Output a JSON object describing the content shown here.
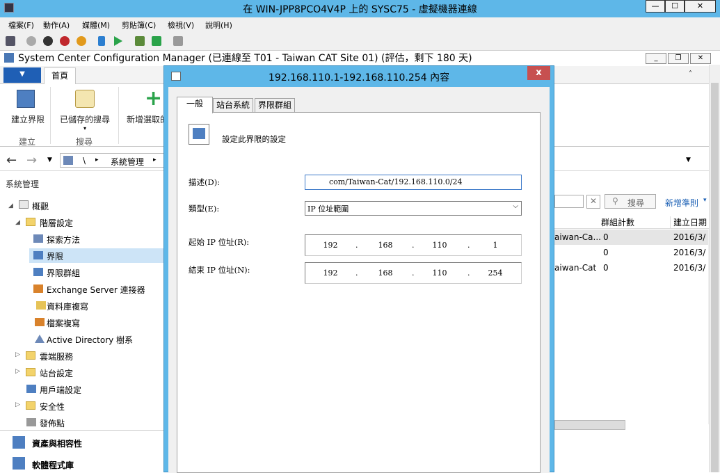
{
  "vm": {
    "title": "在 WIN-JPP8PCO4V4P 上的 SYSC75 - 虛擬機器連線",
    "menu": [
      "檔案(F)",
      "動作(A)",
      "媒體(M)",
      "剪貼簿(C)",
      "檢視(V)",
      "說明(H)"
    ]
  },
  "app": {
    "title": "System Center Configuration Manager (已連線至 T01 - Taiwan CAT Site 01) (評估，剩下 180 天)",
    "ribbon_tab_home": "首頁",
    "ribbon": {
      "create_boundary": "建立界限",
      "saved_searches": "已儲存的搜尋",
      "add_selected": "新增選取的",
      "group_create": "建立",
      "group_search": "搜尋"
    },
    "breadcrumb": [
      "\\",
      "系統管理"
    ]
  },
  "tree": {
    "root": "系統管理",
    "items": [
      "概觀",
      "階層設定",
      "探索方法",
      "界限",
      "界限群組",
      "Exchange Server 連接器",
      "資料庫複寫",
      "檔案複寫",
      "Active Directory 樹系",
      "雲端服務",
      "站台設定",
      "用戶端設定",
      "安全性",
      "發佈點"
    ],
    "workspaces": [
      "資產與相容性",
      "軟體程式庫"
    ]
  },
  "right_panel": {
    "search_button": "搜尋",
    "add_criteria": "新增準則",
    "columns": [
      "群組計數",
      "建立日期"
    ],
    "rows": [
      {
        "name": "aiwan-Ca...",
        "count": "0",
        "date": "2016/3/"
      },
      {
        "name": "",
        "count": "0",
        "date": "2016/3/"
      },
      {
        "name": "aiwan-Cat",
        "count": "0",
        "date": "2016/3/"
      }
    ]
  },
  "dialog": {
    "title": "192.168.110.1-192.168.110.254 內容",
    "close": "x",
    "tabs": [
      "一般",
      "站台系統",
      "界限群組"
    ],
    "header_text": "設定此界限的設定",
    "description_label": "描述(D):",
    "description_value": "com/Taiwan-Cat/192.168.110.0/24",
    "type_label": "類型(E):",
    "type_value": "IP 位址範圍",
    "start_label": "起始 IP 位址(R):",
    "start_ip": [
      "192",
      "168",
      "110",
      "1"
    ],
    "end_label": "結束 IP 位址(N):",
    "end_ip": [
      "192",
      "168",
      "110",
      "254"
    ]
  }
}
